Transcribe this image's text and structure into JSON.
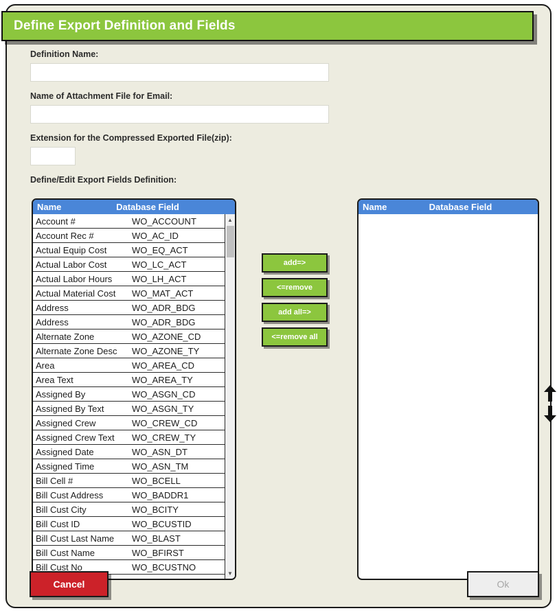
{
  "dialog": {
    "title": "Define Export Definition and Fields",
    "accent_green": "#8cc63e",
    "header_blue": "#4a86d8",
    "cancel_red": "#cc2229",
    "background": "#edece0"
  },
  "form": {
    "definition_name_label": "Definition Name:",
    "definition_name_value": "",
    "attachment_label": "Name of Attachment File for Email:",
    "attachment_value": "",
    "extension_label": "Extension for the Compressed Exported File(zip):",
    "extension_value": "",
    "fields_section_label": "Define/Edit Export Fields Definition:"
  },
  "available_list": {
    "columns": [
      "Name",
      "Database Field"
    ],
    "rows": [
      {
        "name": "Account #",
        "field": "WO_ACCOUNT"
      },
      {
        "name": "Account Rec #",
        "field": "WO_AC_ID"
      },
      {
        "name": "Actual Equip Cost",
        "field": "WO_EQ_ACT"
      },
      {
        "name": "Actual Labor Cost",
        "field": "WO_LC_ACT"
      },
      {
        "name": "Actual Labor Hours",
        "field": "WO_LH_ACT"
      },
      {
        "name": "Actual Material Cost",
        "field": "WO_MAT_ACT"
      },
      {
        "name": "Address",
        "field": "WO_ADR_BDG"
      },
      {
        "name": "Address",
        "field": "WO_ADR_BDG"
      },
      {
        "name": "Alternate Zone",
        "field": "WO_AZONE_CD"
      },
      {
        "name": "Alternate Zone Desc",
        "field": "WO_AZONE_TY"
      },
      {
        "name": "Area",
        "field": "WO_AREA_CD"
      },
      {
        "name": "Area Text",
        "field": "WO_AREA_TY"
      },
      {
        "name": "Assigned By",
        "field": "WO_ASGN_CD"
      },
      {
        "name": "Assigned By Text",
        "field": "WO_ASGN_TY"
      },
      {
        "name": "Assigned Crew",
        "field": "WO_CREW_CD"
      },
      {
        "name": "Assigned Crew Text",
        "field": "WO_CREW_TY"
      },
      {
        "name": "Assigned Date",
        "field": "WO_ASN_DT"
      },
      {
        "name": "Assigned Time",
        "field": "WO_ASN_TM"
      },
      {
        "name": "Bill Cell #",
        "field": "WO_BCELL"
      },
      {
        "name": "Bill Cust Address",
        "field": "WO_BADDR1"
      },
      {
        "name": "Bill Cust City",
        "field": "WO_BCITY"
      },
      {
        "name": "Bill Cust ID",
        "field": "WO_BCUSTID"
      },
      {
        "name": "Bill Cust Last Name",
        "field": "WO_BLAST"
      },
      {
        "name": "Bill Cust Name",
        "field": "WO_BFIRST"
      },
      {
        "name": "Bill Cust No",
        "field": "WO_BCUSTNO"
      }
    ]
  },
  "selected_list": {
    "columns": [
      "Name",
      "Database Field"
    ],
    "rows": []
  },
  "transfer_buttons": [
    {
      "label": "add=>",
      "name": "add-button"
    },
    {
      "label": "<=remove",
      "name": "remove-button"
    },
    {
      "label": "add all=>",
      "name": "add-all-button"
    },
    {
      "label": "<=remove all",
      "name": "remove-all-button"
    }
  ],
  "reorder": {
    "up_title": "Move Up",
    "down_title": "Move Down"
  },
  "footer": {
    "cancel_label": "Cancel",
    "ok_label": "Ok"
  }
}
